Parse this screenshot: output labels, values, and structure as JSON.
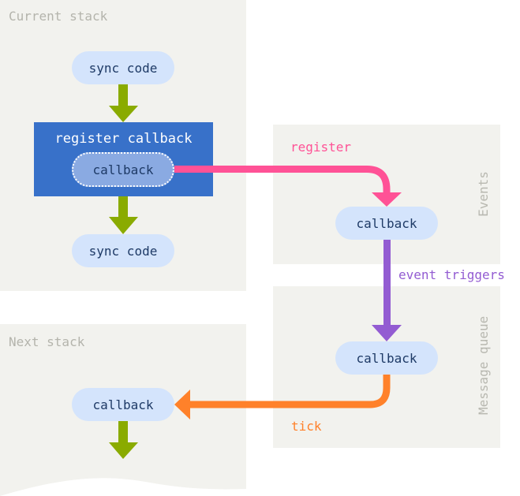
{
  "panels": {
    "current_stack": {
      "title": "Current stack"
    },
    "next_stack": {
      "title": "Next stack"
    },
    "events": {
      "title": "Events"
    },
    "message_queue": {
      "title": "Message queue"
    }
  },
  "nodes": {
    "sync_code_top": "sync code",
    "register_callback": "register callback",
    "register_inner_callback": "callback",
    "sync_code_bottom": "sync code",
    "events_callback": "callback",
    "queue_callback": "callback",
    "next_callback": "callback"
  },
  "edges": {
    "register": {
      "label": "register",
      "color": "#ff5296"
    },
    "event_triggers": {
      "label": "event triggers",
      "color": "#935cd2"
    },
    "tick": {
      "label": "tick",
      "color": "#ff812a"
    },
    "flow_color": "#8aab00"
  }
}
